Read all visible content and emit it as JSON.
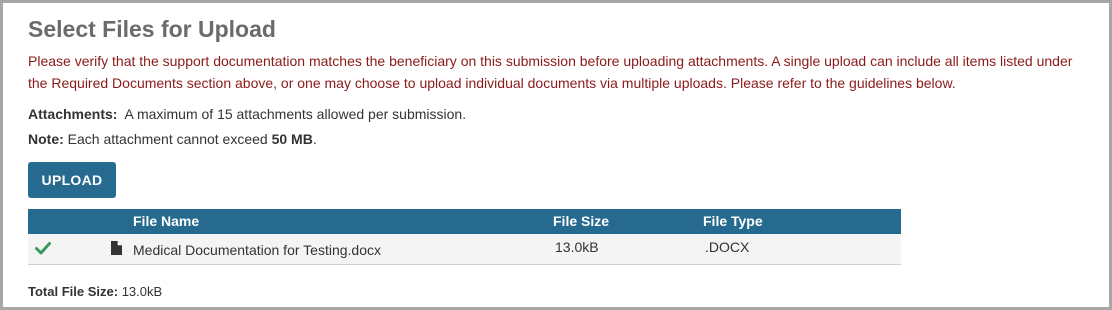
{
  "page": {
    "title": "Select Files for Upload",
    "notice": "Please verify that the support documentation matches the beneficiary on this submission before uploading attachments. A single upload can include all items listed under the Required Documents section above, or one may choose to upload individual documents via multiple uploads. Please refer to the guidelines below."
  },
  "attachments": {
    "label": "Attachments:",
    "text": "A maximum of 15 attachments allowed per submission."
  },
  "note": {
    "label": "Note:",
    "text": "Each attachment cannot exceed",
    "limit": "50 MB",
    "suffix": "."
  },
  "upload_button": {
    "label": "UPLOAD"
  },
  "table": {
    "columns": [
      "File Name",
      "File Size",
      "File Type"
    ],
    "rows": [
      {
        "status_icon": "check-icon",
        "file_icon": "document-icon",
        "file_name": "Medical Documentation for Testing.docx",
        "file_size": "13.0kB",
        "file_type": ".DOCX"
      }
    ]
  },
  "total": {
    "label": "Total File Size:",
    "value": "13.0kB"
  },
  "colors": {
    "header_bg": "#266b8f",
    "notice_text": "#8b1a1a",
    "success_check": "#3c9a5f"
  }
}
